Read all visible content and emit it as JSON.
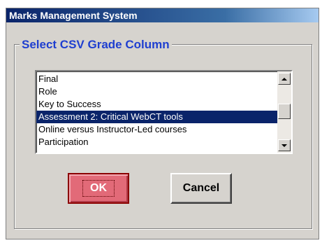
{
  "window": {
    "title": "Marks Management System"
  },
  "group": {
    "legend": "Select CSV Grade Column"
  },
  "listbox": {
    "items": [
      "Final",
      "Role",
      "Key to Success",
      "Assessment 2: Critical WebCT tools",
      "Online versus Instructor-Led courses",
      "Participation"
    ],
    "selected_index": 3
  },
  "buttons": {
    "ok_label": "OK",
    "cancel_label": "Cancel"
  },
  "colors": {
    "title_bar": "#0a246a",
    "legend_text": "#1f3fd0",
    "selection": "#0a246a",
    "ok_button": "#e26a78"
  }
}
